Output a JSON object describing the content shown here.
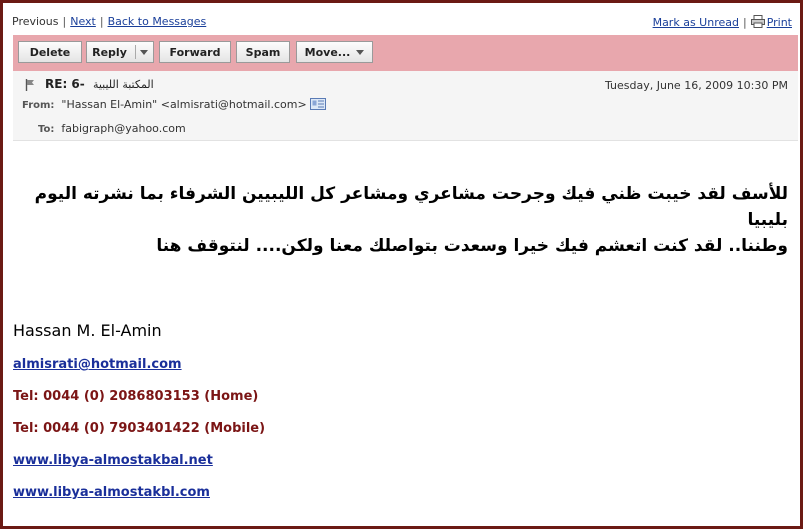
{
  "nav": {
    "previous": "Previous",
    "next": "Next",
    "back": "Back to Messages",
    "mark_unread": "Mark as Unread",
    "print": "Print"
  },
  "toolbar": {
    "delete": "Delete",
    "reply": "Reply",
    "forward": "Forward",
    "spam": "Spam",
    "move": "Move..."
  },
  "message": {
    "subject": "RE: 6-",
    "subject_arabic": "المكتبة الليبية",
    "date": "Tuesday, June 16, 2009 10:30 PM",
    "from_label": "From:",
    "from": "\"Hassan El-Amin\" <almisrati@hotmail.com>",
    "to_label": "To:",
    "to": "fabigraph@yahoo.com"
  },
  "body": {
    "line1": "للأسف لقد خيبت ظني فيك وجرحت مشاعري ومشاعر كل الليبيين الشرفاء بما نشرته اليوم بليبيا",
    "line2": "وطننا.. لقد كنت اتعشم فيك خيرا وسعدت بتواصلك معنا ولكن.... لنتوقف هنا"
  },
  "signature": {
    "name": "Hassan M. El-Amin",
    "email": "almisrati@hotmail.com",
    "tel_home": "Tel: 0044 (0) 2086803153 (Home)",
    "tel_mobile": "Tel: 0044 (0) 7903401422 (Mobile)",
    "site1": "www.libya-almostakbal.net",
    "site2": "www.libya-almostakbl.com"
  },
  "colors": {
    "toolbar_bg": "#e8a7ad",
    "link": "#1a3f9a",
    "tel": "#7b1515",
    "frame": "#6b1a14"
  }
}
